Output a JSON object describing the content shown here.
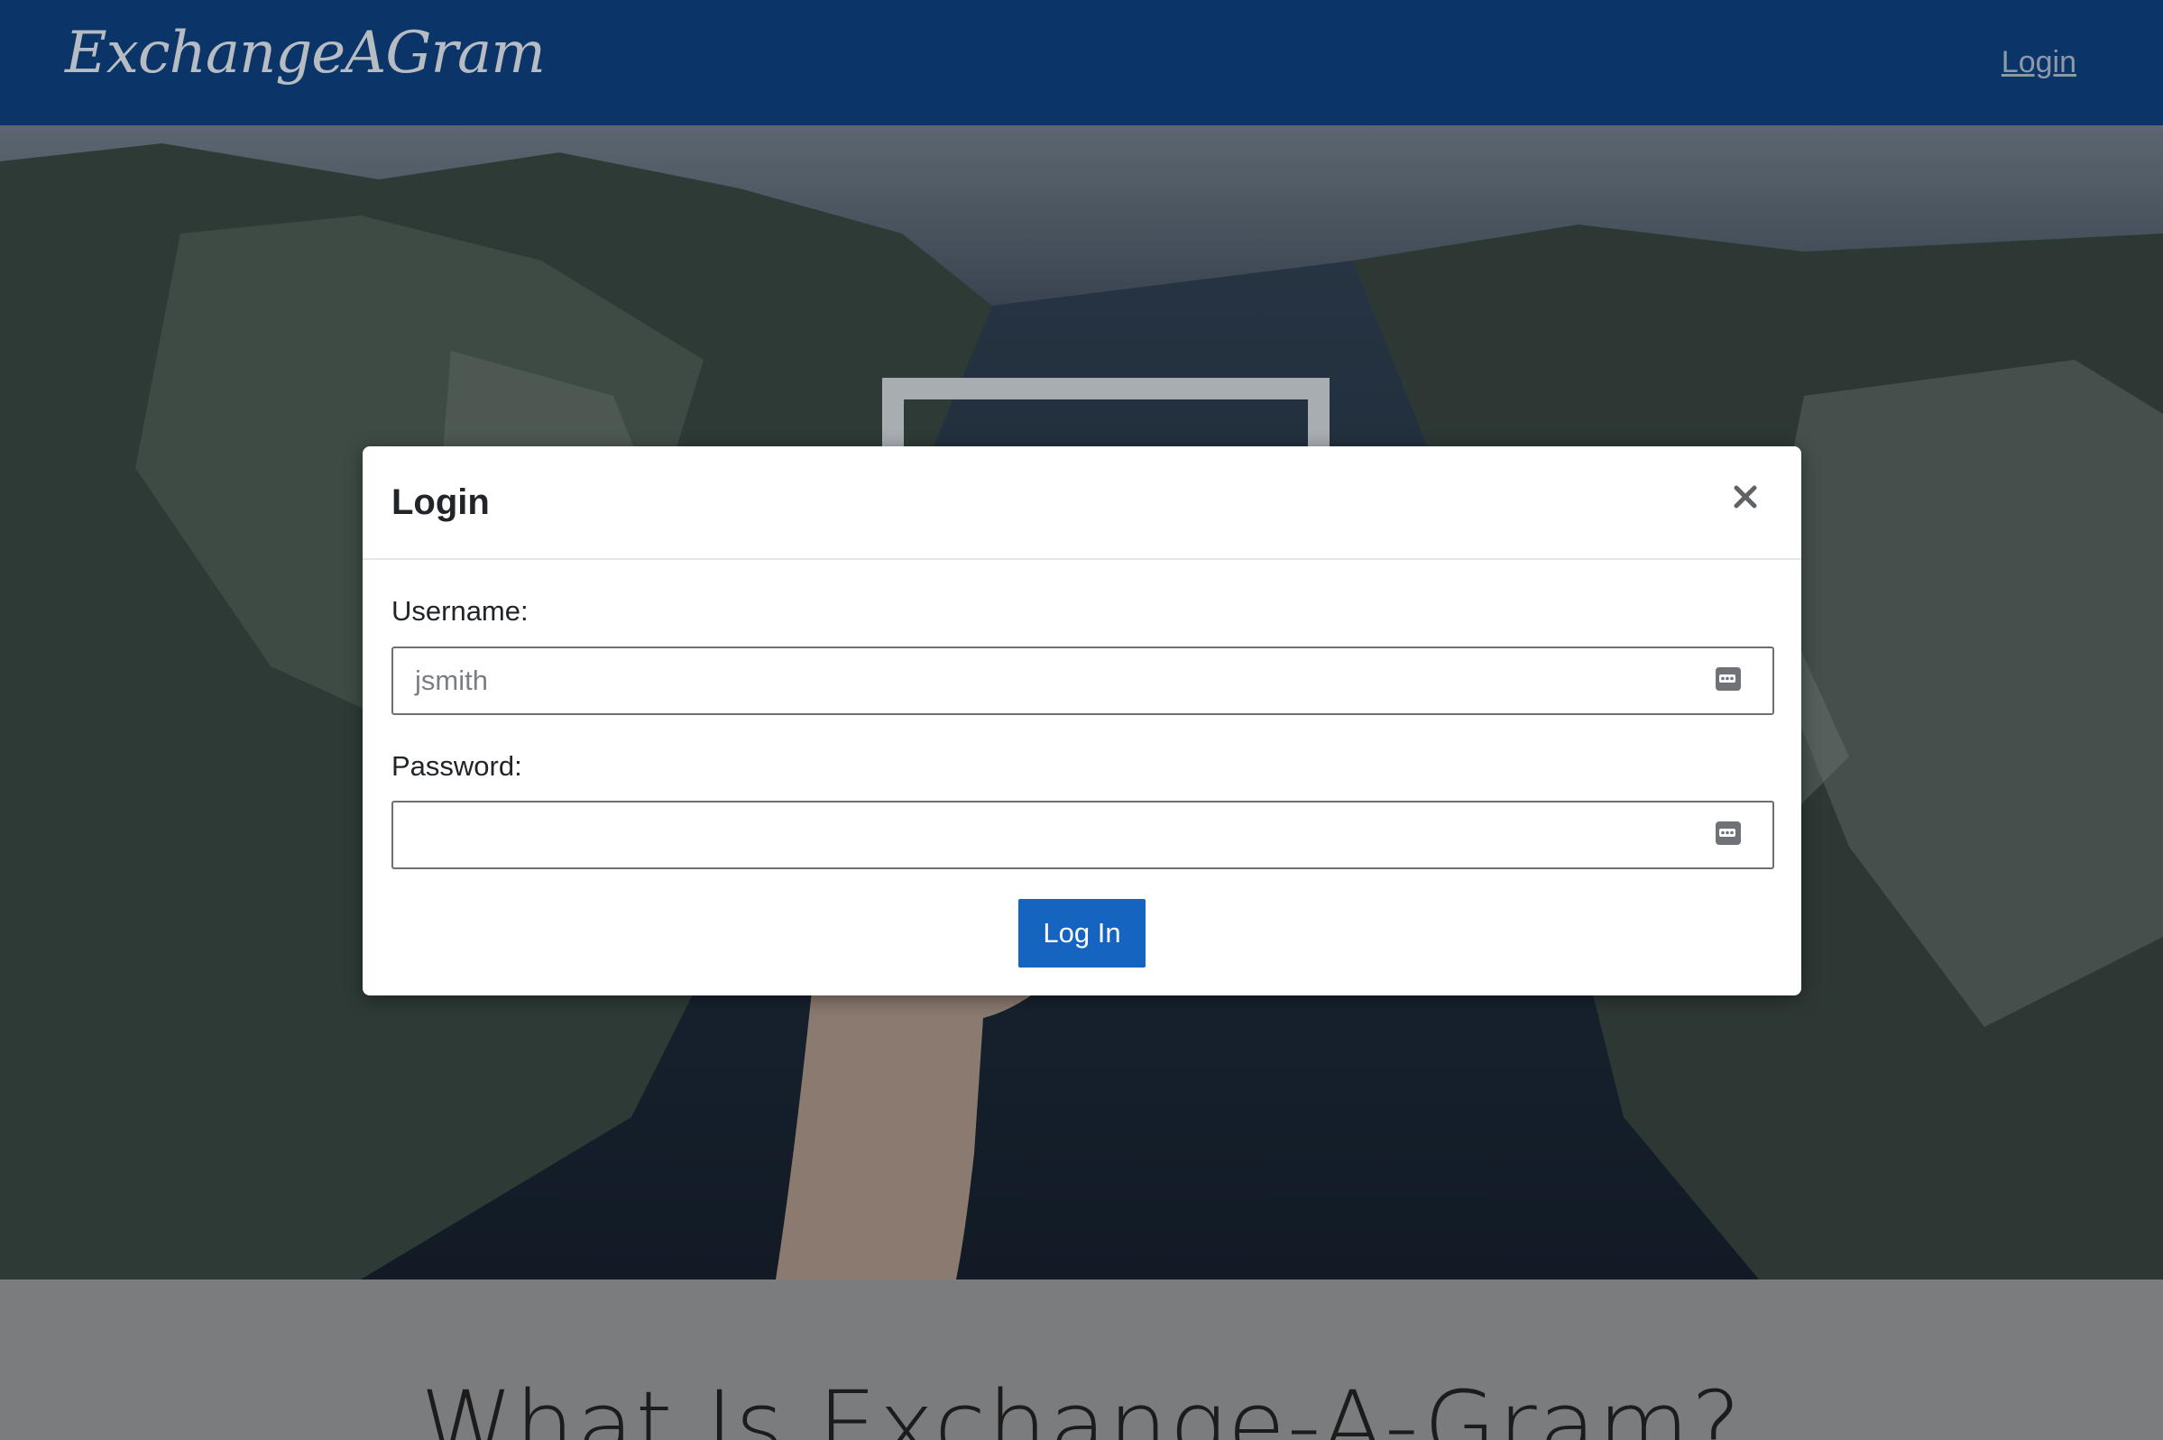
{
  "navbar": {
    "brand": "ExchangeAGram",
    "login_link": "Login"
  },
  "hero": {
    "image_alt_icon": "landscape-photo"
  },
  "info": {
    "title": "What Is Exchange-A-Gram?"
  },
  "modal": {
    "title": "Login",
    "close_icon": "close-icon",
    "username_label": "Username:",
    "username_placeholder": "jsmith",
    "password_label": "Password:",
    "password_placeholder": "",
    "submit_label": "Log In"
  },
  "colors": {
    "navbar": "#0b3568",
    "button": "#1565c0"
  }
}
